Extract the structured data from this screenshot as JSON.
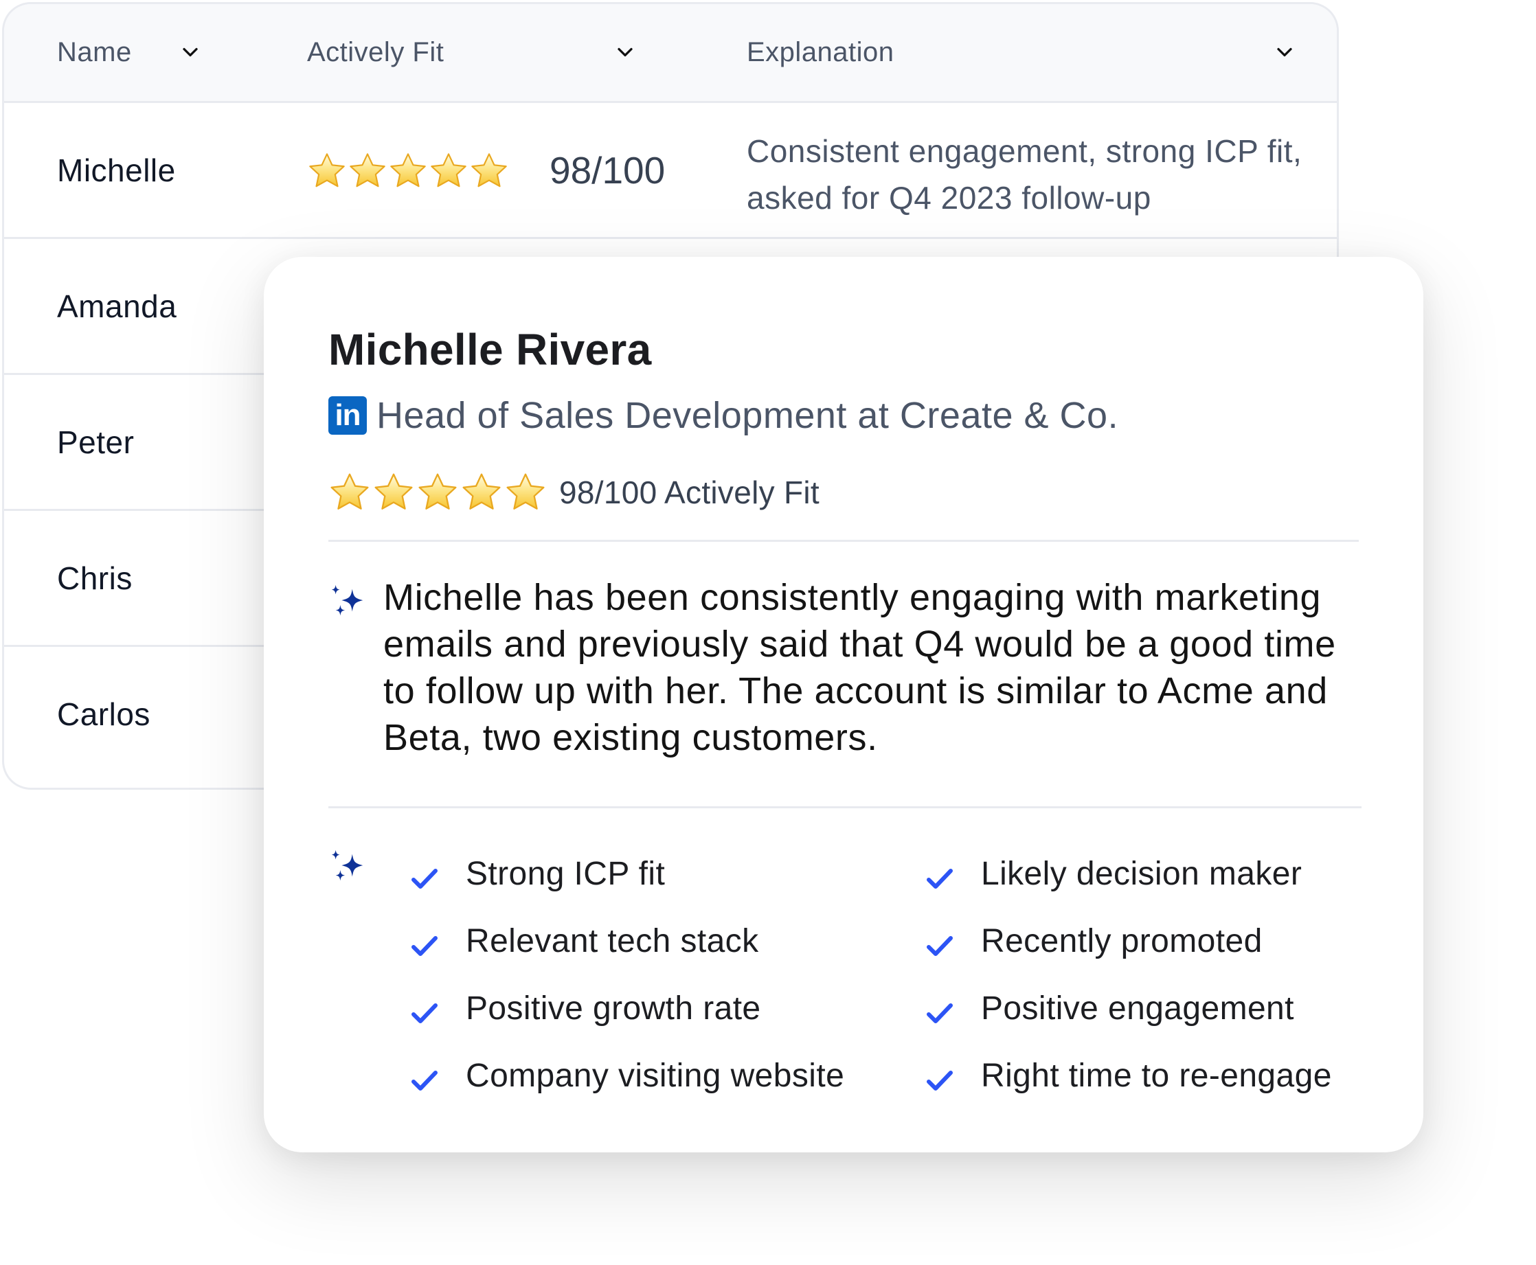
{
  "table": {
    "columns": [
      {
        "label": "Name"
      },
      {
        "label": "Actively Fit"
      },
      {
        "label": "Explanation"
      }
    ],
    "rows": [
      {
        "name": "Michelle",
        "stars": 5,
        "score": "98/100",
        "explanation": "Consistent engagement, strong ICP fit, asked for Q4 2023 follow-up"
      },
      {
        "name": "Amanda"
      },
      {
        "name": "Peter"
      },
      {
        "name": "Chris"
      },
      {
        "name": "Carlos"
      }
    ]
  },
  "profile": {
    "name": "Michelle Rivera",
    "linkedin_icon": "in",
    "title": "Head of Sales Development at Create & Co.",
    "stars": 5,
    "rating_text": "98/100 Actively Fit",
    "summary": "Michelle has been consistently engaging with marketing emails and previously said that Q4 would be a good time to follow up with her. The account is similar to Acme and Beta, two existing customers.",
    "signals": [
      "Strong ICP fit",
      "Likely decision maker",
      "Relevant tech stack",
      "Recently promoted",
      "Positive growth rate",
      "Positive engagement",
      "Company visiting website",
      "Right time to re-engage"
    ]
  },
  "colors": {
    "accent_check": "#2c54f5",
    "sparkle": "#0f3297",
    "linkedin": "#0a66c2",
    "star_fill": "#f7c531"
  }
}
